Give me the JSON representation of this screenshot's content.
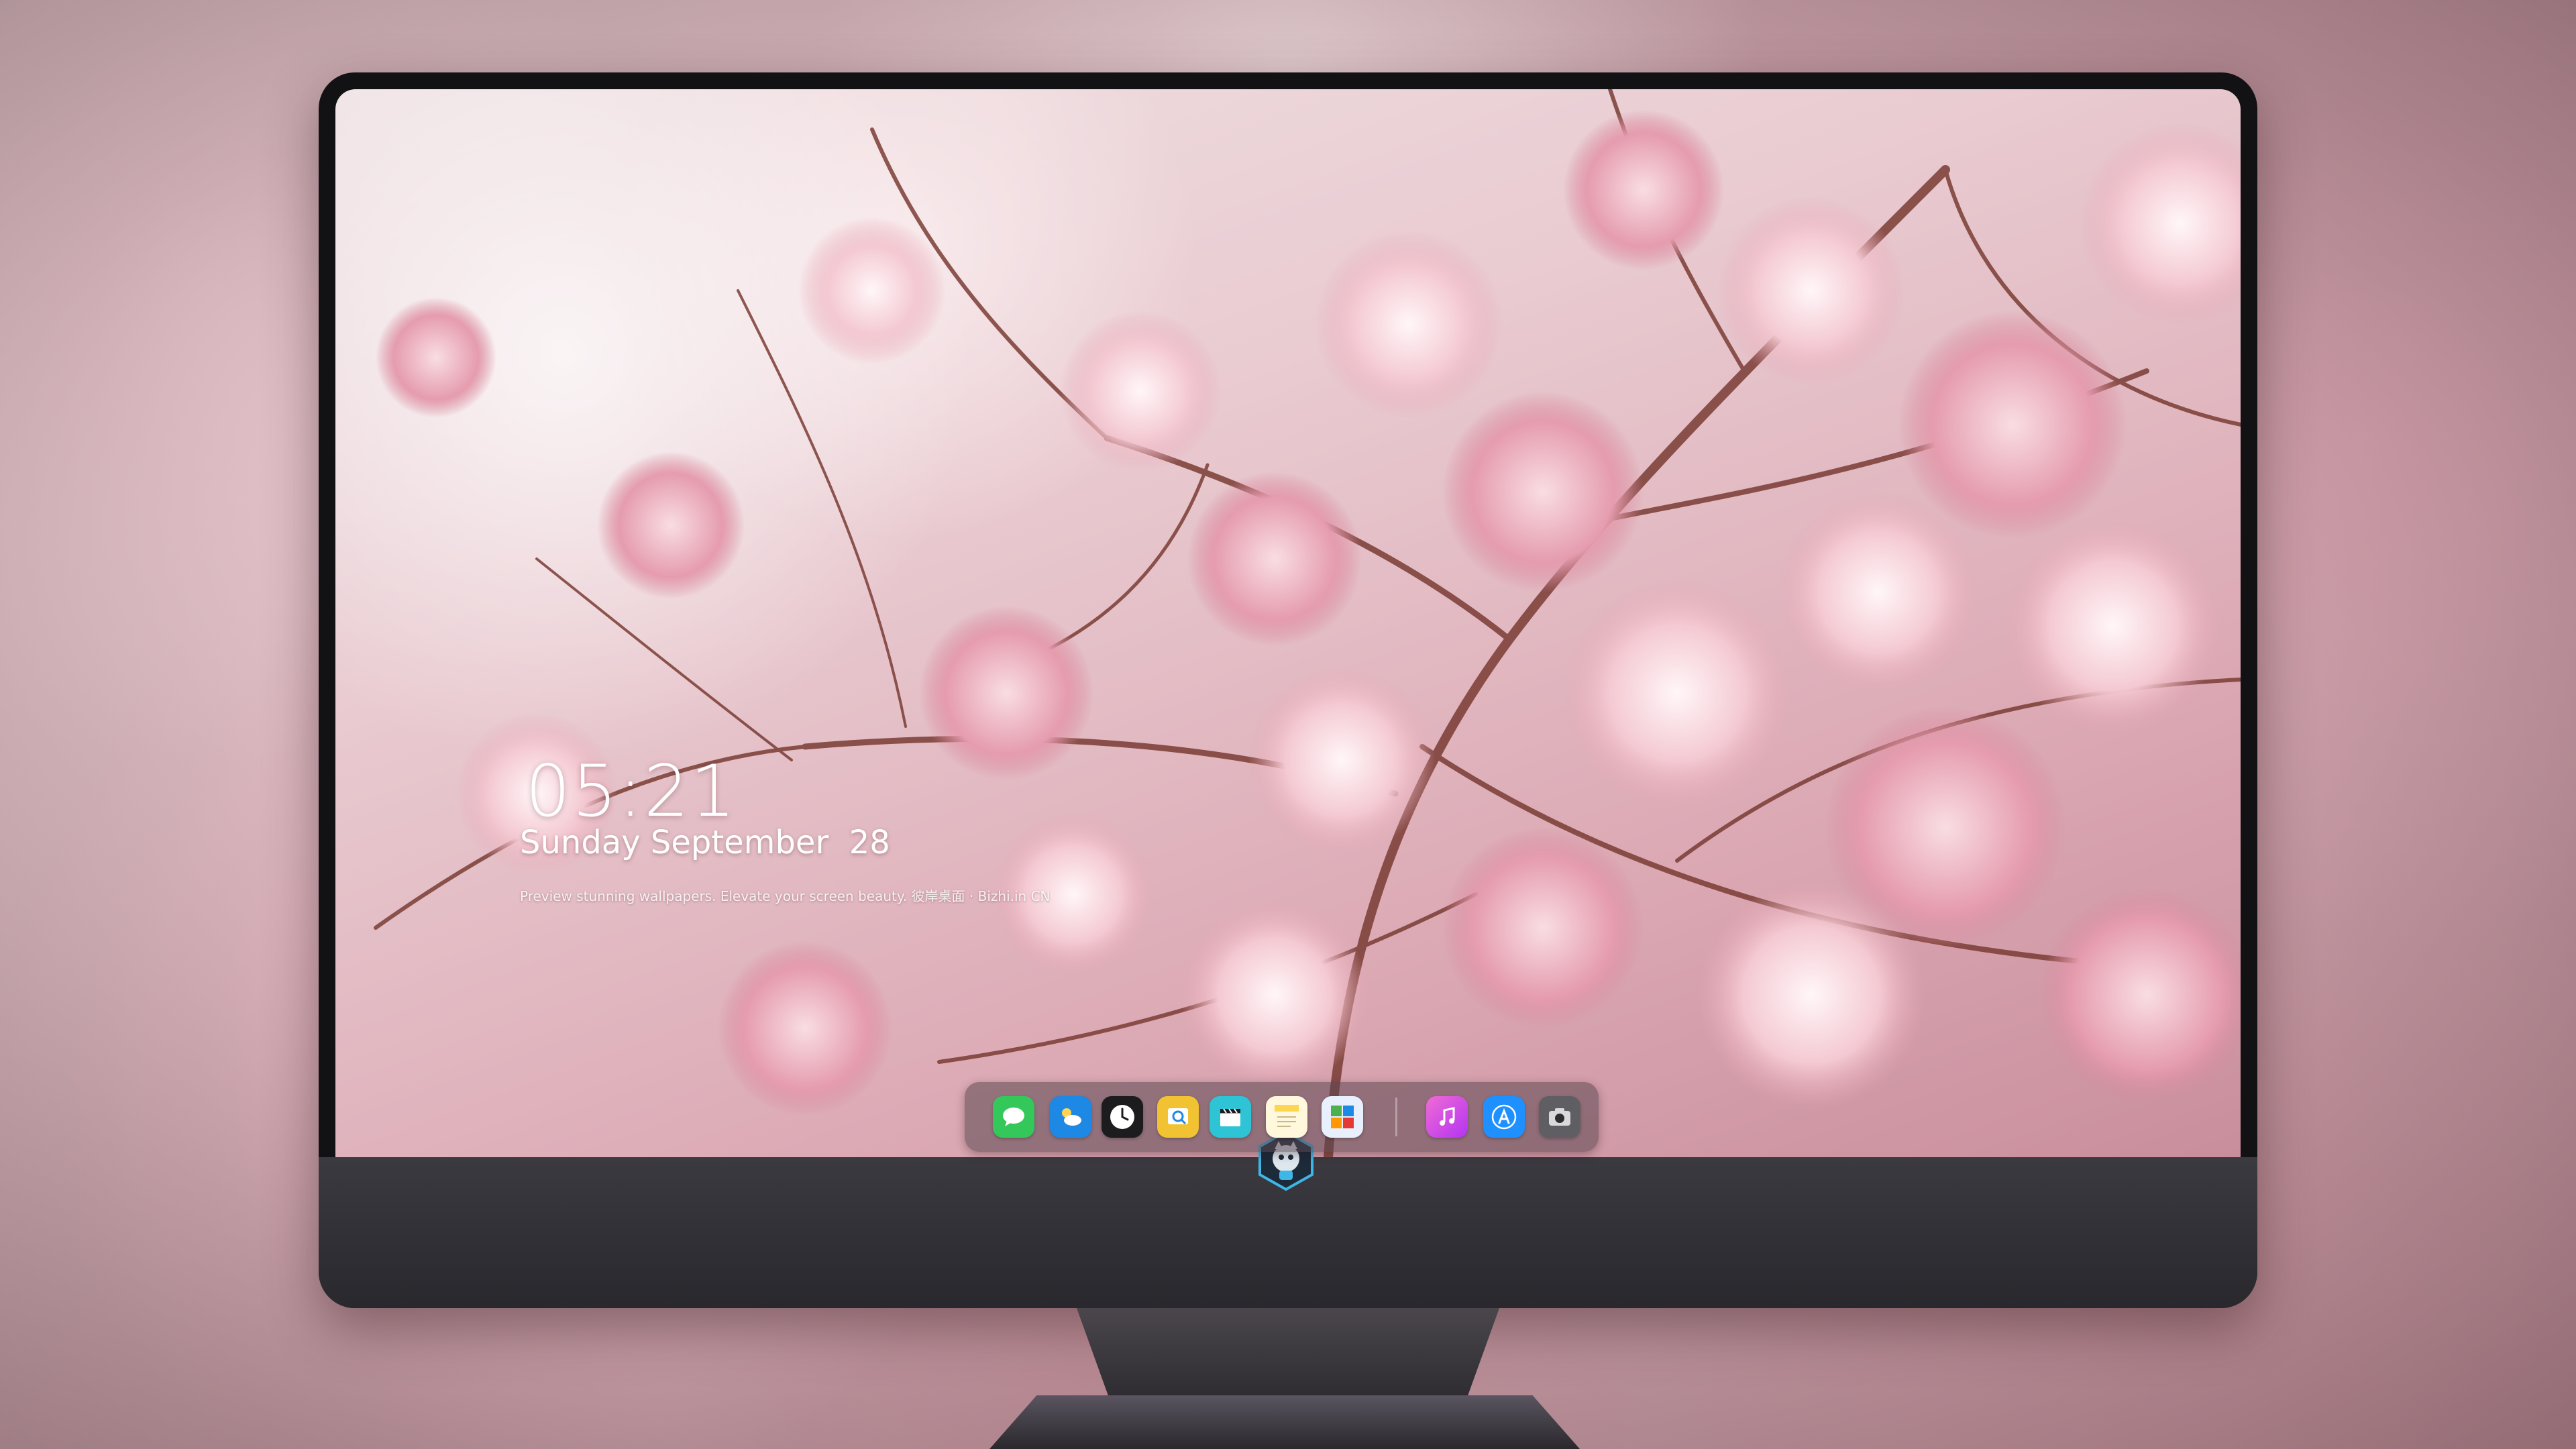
{
  "lock_screen": {
    "time": "05:21",
    "date": "Sunday September  28",
    "tagline": "Preview stunning wallpapers. Elevate your screen beauty. 彼岸桌面 · Bizhi.in CN"
  },
  "dock": {
    "apps": [
      {
        "name": "Messages",
        "icon": "messages-icon",
        "color": "#34c759"
      },
      {
        "name": "Weather",
        "icon": "weather-icon",
        "color": "#1e88e5"
      },
      {
        "name": "Clock",
        "icon": "clock-icon",
        "color": "#1c1c1e"
      },
      {
        "name": "Preview",
        "icon": "preview-icon",
        "color": "#f1c232"
      },
      {
        "name": "Video",
        "icon": "clapperboard-icon",
        "color": "#2ec4d6"
      },
      {
        "name": "Notes",
        "icon": "notes-icon",
        "color": "#ffd54f"
      },
      {
        "name": "Photo Booth",
        "icon": "photo-gallery-icon",
        "color": "#4caf50"
      },
      {
        "name": "Music",
        "icon": "music-icon",
        "color": "#d63af9"
      },
      {
        "name": "App Store",
        "icon": "app-store-icon",
        "color": "#1e90ff"
      },
      {
        "name": "Camera",
        "icon": "camera-icon",
        "color": "#5f5f63"
      }
    ]
  },
  "monitor": {
    "logo": "mascot-logo-icon"
  }
}
